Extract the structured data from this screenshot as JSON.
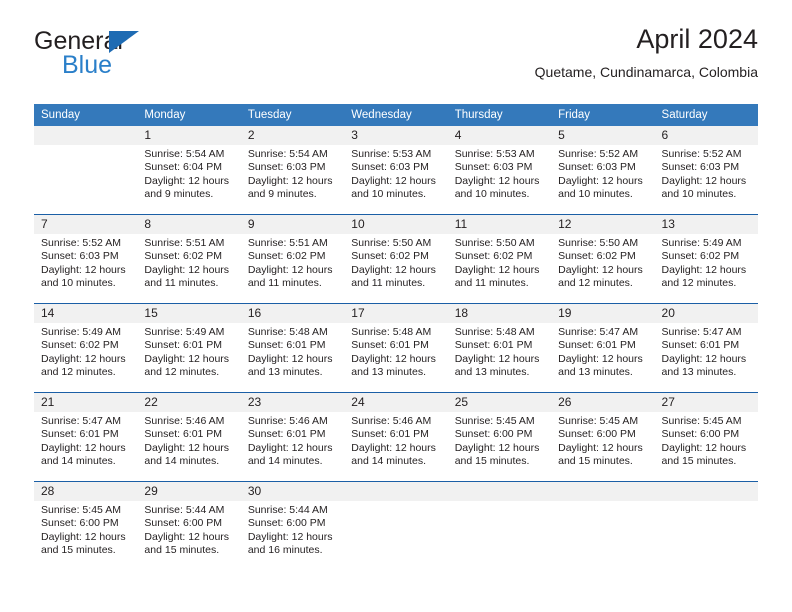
{
  "brand": {
    "line1": "General",
    "line2": "Blue",
    "flag_color": "#1e6bb3",
    "line2_color": "#2a7fc9"
  },
  "header": {
    "title": "April 2024",
    "subtitle": "Quetame, Cundinamarca, Colombia"
  },
  "theme": {
    "header_blue": "#3479bb",
    "row_rule": "#1b5fa6",
    "daynum_band": "#f1f1f1",
    "text": "#231f20"
  },
  "weekday_headers": [
    "Sunday",
    "Monday",
    "Tuesday",
    "Wednesday",
    "Thursday",
    "Friday",
    "Saturday"
  ],
  "weeks": [
    [
      {
        "day": "",
        "sunrise": "",
        "sunset": "",
        "daylight_line1": "",
        "daylight_line2": ""
      },
      {
        "day": "1",
        "sunrise": "Sunrise: 5:54 AM",
        "sunset": "Sunset: 6:04 PM",
        "daylight_line1": "Daylight: 12 hours",
        "daylight_line2": "and 9 minutes."
      },
      {
        "day": "2",
        "sunrise": "Sunrise: 5:54 AM",
        "sunset": "Sunset: 6:03 PM",
        "daylight_line1": "Daylight: 12 hours",
        "daylight_line2": "and 9 minutes."
      },
      {
        "day": "3",
        "sunrise": "Sunrise: 5:53 AM",
        "sunset": "Sunset: 6:03 PM",
        "daylight_line1": "Daylight: 12 hours",
        "daylight_line2": "and 10 minutes."
      },
      {
        "day": "4",
        "sunrise": "Sunrise: 5:53 AM",
        "sunset": "Sunset: 6:03 PM",
        "daylight_line1": "Daylight: 12 hours",
        "daylight_line2": "and 10 minutes."
      },
      {
        "day": "5",
        "sunrise": "Sunrise: 5:52 AM",
        "sunset": "Sunset: 6:03 PM",
        "daylight_line1": "Daylight: 12 hours",
        "daylight_line2": "and 10 minutes."
      },
      {
        "day": "6",
        "sunrise": "Sunrise: 5:52 AM",
        "sunset": "Sunset: 6:03 PM",
        "daylight_line1": "Daylight: 12 hours",
        "daylight_line2": "and 10 minutes."
      }
    ],
    [
      {
        "day": "7",
        "sunrise": "Sunrise: 5:52 AM",
        "sunset": "Sunset: 6:03 PM",
        "daylight_line1": "Daylight: 12 hours",
        "daylight_line2": "and 10 minutes."
      },
      {
        "day": "8",
        "sunrise": "Sunrise: 5:51 AM",
        "sunset": "Sunset: 6:02 PM",
        "daylight_line1": "Daylight: 12 hours",
        "daylight_line2": "and 11 minutes."
      },
      {
        "day": "9",
        "sunrise": "Sunrise: 5:51 AM",
        "sunset": "Sunset: 6:02 PM",
        "daylight_line1": "Daylight: 12 hours",
        "daylight_line2": "and 11 minutes."
      },
      {
        "day": "10",
        "sunrise": "Sunrise: 5:50 AM",
        "sunset": "Sunset: 6:02 PM",
        "daylight_line1": "Daylight: 12 hours",
        "daylight_line2": "and 11 minutes."
      },
      {
        "day": "11",
        "sunrise": "Sunrise: 5:50 AM",
        "sunset": "Sunset: 6:02 PM",
        "daylight_line1": "Daylight: 12 hours",
        "daylight_line2": "and 11 minutes."
      },
      {
        "day": "12",
        "sunrise": "Sunrise: 5:50 AM",
        "sunset": "Sunset: 6:02 PM",
        "daylight_line1": "Daylight: 12 hours",
        "daylight_line2": "and 12 minutes."
      },
      {
        "day": "13",
        "sunrise": "Sunrise: 5:49 AM",
        "sunset": "Sunset: 6:02 PM",
        "daylight_line1": "Daylight: 12 hours",
        "daylight_line2": "and 12 minutes."
      }
    ],
    [
      {
        "day": "14",
        "sunrise": "Sunrise: 5:49 AM",
        "sunset": "Sunset: 6:02 PM",
        "daylight_line1": "Daylight: 12 hours",
        "daylight_line2": "and 12 minutes."
      },
      {
        "day": "15",
        "sunrise": "Sunrise: 5:49 AM",
        "sunset": "Sunset: 6:01 PM",
        "daylight_line1": "Daylight: 12 hours",
        "daylight_line2": "and 12 minutes."
      },
      {
        "day": "16",
        "sunrise": "Sunrise: 5:48 AM",
        "sunset": "Sunset: 6:01 PM",
        "daylight_line1": "Daylight: 12 hours",
        "daylight_line2": "and 13 minutes."
      },
      {
        "day": "17",
        "sunrise": "Sunrise: 5:48 AM",
        "sunset": "Sunset: 6:01 PM",
        "daylight_line1": "Daylight: 12 hours",
        "daylight_line2": "and 13 minutes."
      },
      {
        "day": "18",
        "sunrise": "Sunrise: 5:48 AM",
        "sunset": "Sunset: 6:01 PM",
        "daylight_line1": "Daylight: 12 hours",
        "daylight_line2": "and 13 minutes."
      },
      {
        "day": "19",
        "sunrise": "Sunrise: 5:47 AM",
        "sunset": "Sunset: 6:01 PM",
        "daylight_line1": "Daylight: 12 hours",
        "daylight_line2": "and 13 minutes."
      },
      {
        "day": "20",
        "sunrise": "Sunrise: 5:47 AM",
        "sunset": "Sunset: 6:01 PM",
        "daylight_line1": "Daylight: 12 hours",
        "daylight_line2": "and 13 minutes."
      }
    ],
    [
      {
        "day": "21",
        "sunrise": "Sunrise: 5:47 AM",
        "sunset": "Sunset: 6:01 PM",
        "daylight_line1": "Daylight: 12 hours",
        "daylight_line2": "and 14 minutes."
      },
      {
        "day": "22",
        "sunrise": "Sunrise: 5:46 AM",
        "sunset": "Sunset: 6:01 PM",
        "daylight_line1": "Daylight: 12 hours",
        "daylight_line2": "and 14 minutes."
      },
      {
        "day": "23",
        "sunrise": "Sunrise: 5:46 AM",
        "sunset": "Sunset: 6:01 PM",
        "daylight_line1": "Daylight: 12 hours",
        "daylight_line2": "and 14 minutes."
      },
      {
        "day": "24",
        "sunrise": "Sunrise: 5:46 AM",
        "sunset": "Sunset: 6:01 PM",
        "daylight_line1": "Daylight: 12 hours",
        "daylight_line2": "and 14 minutes."
      },
      {
        "day": "25",
        "sunrise": "Sunrise: 5:45 AM",
        "sunset": "Sunset: 6:00 PM",
        "daylight_line1": "Daylight: 12 hours",
        "daylight_line2": "and 15 minutes."
      },
      {
        "day": "26",
        "sunrise": "Sunrise: 5:45 AM",
        "sunset": "Sunset: 6:00 PM",
        "daylight_line1": "Daylight: 12 hours",
        "daylight_line2": "and 15 minutes."
      },
      {
        "day": "27",
        "sunrise": "Sunrise: 5:45 AM",
        "sunset": "Sunset: 6:00 PM",
        "daylight_line1": "Daylight: 12 hours",
        "daylight_line2": "and 15 minutes."
      }
    ],
    [
      {
        "day": "28",
        "sunrise": "Sunrise: 5:45 AM",
        "sunset": "Sunset: 6:00 PM",
        "daylight_line1": "Daylight: 12 hours",
        "daylight_line2": "and 15 minutes."
      },
      {
        "day": "29",
        "sunrise": "Sunrise: 5:44 AM",
        "sunset": "Sunset: 6:00 PM",
        "daylight_line1": "Daylight: 12 hours",
        "daylight_line2": "and 15 minutes."
      },
      {
        "day": "30",
        "sunrise": "Sunrise: 5:44 AM",
        "sunset": "Sunset: 6:00 PM",
        "daylight_line1": "Daylight: 12 hours",
        "daylight_line2": "and 16 minutes."
      },
      {
        "day": "",
        "sunrise": "",
        "sunset": "",
        "daylight_line1": "",
        "daylight_line2": ""
      },
      {
        "day": "",
        "sunrise": "",
        "sunset": "",
        "daylight_line1": "",
        "daylight_line2": ""
      },
      {
        "day": "",
        "sunrise": "",
        "sunset": "",
        "daylight_line1": "",
        "daylight_line2": ""
      },
      {
        "day": "",
        "sunrise": "",
        "sunset": "",
        "daylight_line1": "",
        "daylight_line2": ""
      }
    ]
  ]
}
